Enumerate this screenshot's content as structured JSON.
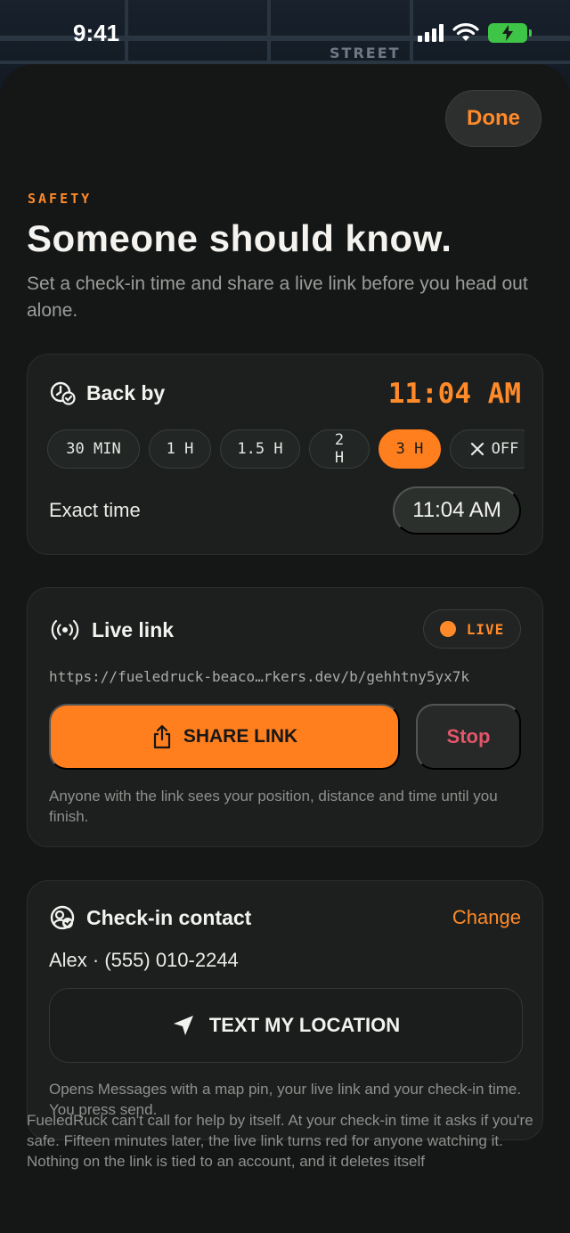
{
  "status_bar": {
    "time": "9:41"
  },
  "map": {
    "street_label": "STREET"
  },
  "header": {
    "done_label": "Done"
  },
  "intro": {
    "eyebrow": "SAFETY",
    "title": "Someone should know.",
    "subtitle": "Set a check-in time and share a live link before you head out alone."
  },
  "back_by": {
    "label": "Back by",
    "time": "11:04 AM",
    "chips": [
      "30 MIN",
      "1 H",
      "1.5 H",
      "2 H",
      "3 H",
      "OFF"
    ],
    "selected_chip": "3 H",
    "exact_label": "Exact time",
    "exact_value": "11:04 AM"
  },
  "live_link": {
    "label": "Live link",
    "status": "LIVE",
    "url": "https://fueledruck-beaco…rkers.dev/b/gehhtny5yx7k",
    "share_label": "SHARE LINK",
    "stop_label": "Stop",
    "note": "Anyone with the link sees your position, distance and time until you finish."
  },
  "contact": {
    "label": "Check-in contact",
    "change_label": "Change",
    "name": "Alex · (555) 010-2244",
    "text_label": "TEXT MY LOCATION",
    "note": "Opens Messages with a map pin, your live link and your check-in time. You press send."
  },
  "footer": {
    "note": "FueledRuck can't call for help by itself. At your check-in time it asks if you're safe. Fifteen minutes later, the live link turns red for anyone watching it. Nothing on the link is tied to an account, and it deletes itself"
  },
  "colors": {
    "accent": "#ff8a2a",
    "danger": "#e2556a",
    "battery": "#3ec446"
  }
}
